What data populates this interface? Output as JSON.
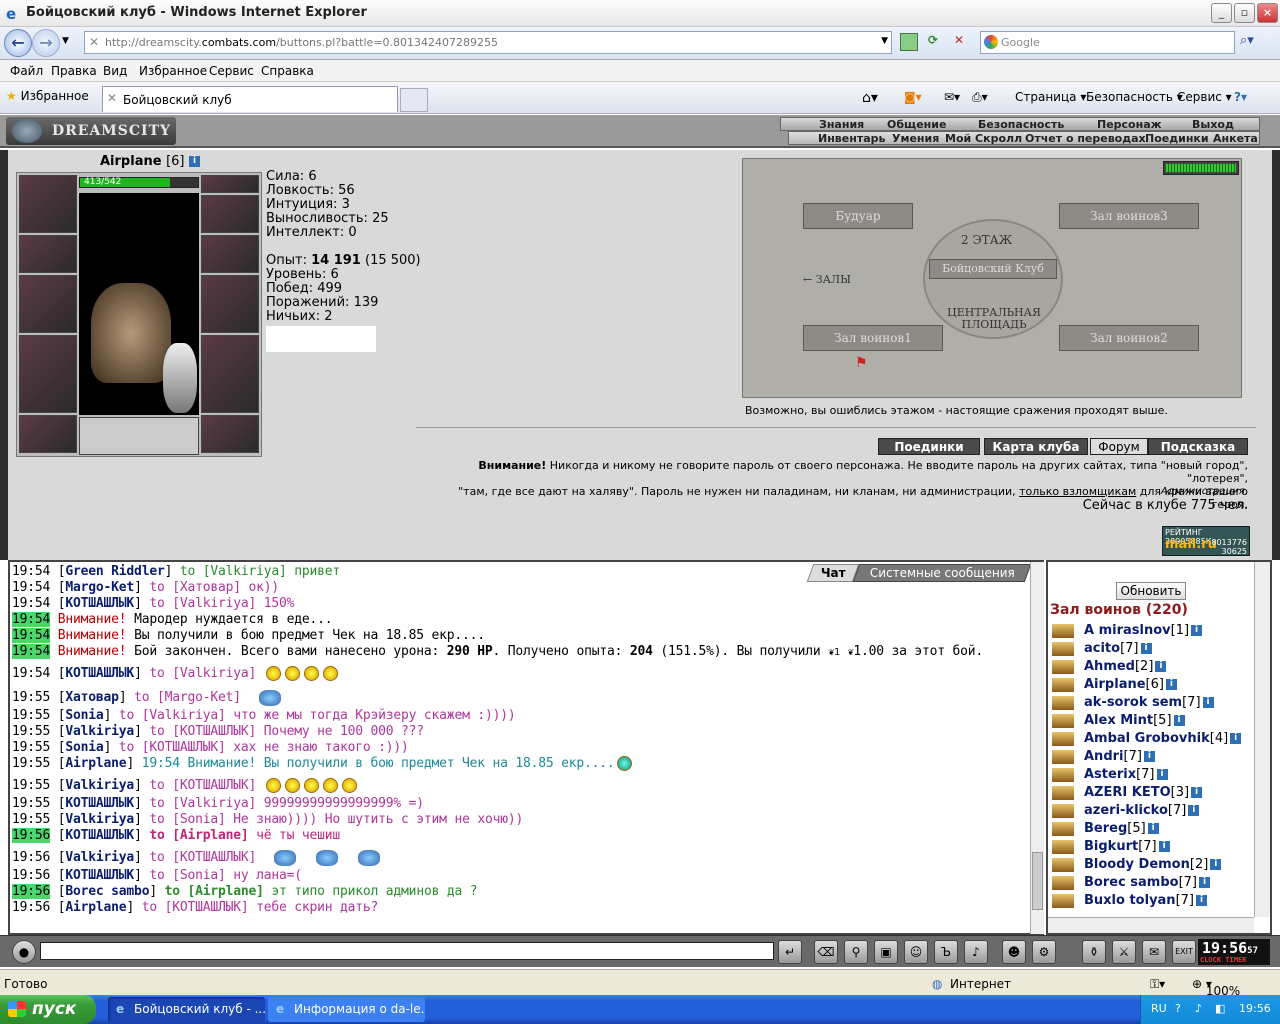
{
  "window": {
    "title": "Бойцовский клуб - Windows Internet Explorer"
  },
  "address": {
    "url_prefix": "http://dreamscity.",
    "url_domain": "combats.com",
    "url_suffix": "/buttons.pl?battle=0.801342407289255",
    "search_placeholder": "Google"
  },
  "menu": [
    "Файл",
    "Правка",
    "Вид",
    "Избранное",
    "Сервис",
    "Справка"
  ],
  "tabbar": {
    "favorites": "Избранное",
    "tab_title": "Бойцовский клуб",
    "page_menu": "Страница",
    "safety_menu": "Безопасность",
    "tools_menu": "Сервис"
  },
  "game_nav": {
    "logo": "DREAMSCITY",
    "row1": [
      "Знания",
      "Общение",
      "Безопасность",
      "Персонаж",
      "Выход"
    ],
    "row2": [
      "Инвентарь",
      "Умения",
      "Мой Скролл",
      "Отчет о переводах",
      "Поединки",
      "Анкета"
    ]
  },
  "character": {
    "name": "Airplane",
    "level": "[6]",
    "hp": "413/542",
    "hp_fraction": 0.762,
    "stats": [
      {
        "label": "Сила:",
        "value": "6"
      },
      {
        "label": "Ловкость:",
        "value": "56"
      },
      {
        "label": "Интуиция:",
        "value": "3"
      },
      {
        "label": "Выносливость:",
        "value": "25"
      },
      {
        "label": "Интеллект:",
        "value": "0"
      }
    ],
    "exp_label": "Опыт:",
    "exp_value": "14 191",
    "exp_next": "(15 500)",
    "stats2": [
      {
        "label": "Уровень:",
        "value": "6"
      },
      {
        "label": "Побед:",
        "value": "499"
      },
      {
        "label": "Поражений:",
        "value": "139"
      },
      {
        "label": "Ничьих:",
        "value": "2"
      }
    ]
  },
  "map": {
    "floor_label": "2 ЭТАЖ",
    "center_label": "Бойцовский Клуб",
    "plaza_label": "ЦЕНТРАЛЬНАЯ ПЛОЩАДЬ",
    "rooms": [
      "Будуар",
      "Зал воинов3",
      "Зал воинов1",
      "Зал воинов2"
    ],
    "halls_label": "← ЗАЛЫ",
    "note": "Возможно, вы ошиблись этажом - настоящие сражения проходят выше."
  },
  "buttons": [
    "Поединки",
    "Карта клуба",
    "Форум",
    "Подсказка"
  ],
  "warning": {
    "bold": "Внимание!",
    "text1": " Никогда и никому не говорите пароль от своего персонажа. Не вводите пароль на других сайтах, типа \"новый город\", \"лотерея\",",
    "text2": "\"там, где все дают на халяву\". Пароль не нужен ни паладинам, ни кланам, ни администрации, ",
    "link": "только взломщикам",
    "text3": " для кражи вашего героя.",
    "admin": "Администрация.",
    "online": "Сейчас в клубе 775 чел."
  },
  "mailru": {
    "line1": "РЕЙТИНГ 28905885К",
    "logo": "mail.ru",
    "n1": "8013776",
    "n2": "30625"
  },
  "chat_tabs": [
    "Чат",
    "Системные сообщения"
  ],
  "chat": [
    {
      "t": "19:54",
      "a": "Green Riddler",
      "to": "Valkiriya",
      "m": "привет"
    },
    {
      "t": "19:54",
      "a": "Margo-Ket",
      "to": "Хатовар",
      "m": "ок))"
    },
    {
      "t": "19:54",
      "a": "КОТШАШЛЫК",
      "to": "Valkiriya",
      "m": "150%"
    },
    {
      "t": "19:54",
      "sys": "Внимание!",
      "m": "Мародер нуждается в еде..."
    },
    {
      "t": "19:54",
      "sys": "Внимание!",
      "m": "Вы получили в бою предмет Чек на 18.85 екр...."
    },
    {
      "t": "19:54",
      "sys": "Внимание!",
      "m1": "Бой закончен. Всего вами нанесено урона:",
      "b1": "290 HP",
      "m2": ". Получено опыта:",
      "b2": "204",
      "m3": "(151.5%). Вы получили",
      "m4": "1",
      "m5": "1.00 за этот бой."
    },
    {
      "t": "19:54",
      "a": "КОТШАШЛЫК",
      "to": "Valkiriya",
      "m": ""
    },
    {
      "t": "19:55",
      "a": "Хатовар",
      "to": "Margo-Ket",
      "m": ""
    },
    {
      "t": "19:55",
      "a": "Sonia",
      "to": "Valkiriya",
      "m": "что же мы тогда Крэйзеру скажем :))))"
    },
    {
      "t": "19:55",
      "a": "Valkiriya",
      "to": "КОТШАШЛЫК",
      "m": "Почему не 100 000 ???"
    },
    {
      "t": "19:55",
      "a": "Sonia",
      "to": "КОТШАШЛЫК",
      "m": "хах не знаю такого :)))"
    },
    {
      "t": "19:55",
      "a": "Airplane",
      "m": "19:54 Внимание! Вы получили в бою предмет Чек на 18.85 екр...."
    },
    {
      "t": "19:55",
      "a": "Valkiriya",
      "to": "КОТШАШЛЫК",
      "m": ""
    },
    {
      "t": "19:55",
      "a": "КОТШАШЛЫК",
      "to": "Valkiriya",
      "m": "99999999999999999% =)"
    },
    {
      "t": "19:55",
      "a": "Valkiriya",
      "to": "Sonia",
      "m": "Не знаю)))) Но шутить с этим не хочю))"
    },
    {
      "t": "19:56",
      "a": "КОТШАШЛЫК",
      "to": "Airplane",
      "m": "чё ты чешиш"
    },
    {
      "t": "19:56",
      "a": "Valkiriya",
      "to": "КОТШАШЛЫК",
      "m": ""
    },
    {
      "t": "19:56",
      "a": "КОТШАШЛЫК",
      "to": "Sonia",
      "m": "ну лана=("
    },
    {
      "t": "19:56",
      "a": "Borec sambo",
      "to": "Airplane",
      "m": "эт типо прикол админов да ?"
    },
    {
      "t": "19:56",
      "a": "Airplane",
      "to": "КОТШАШЛЫК",
      "m": "тебе скрин дать?"
    }
  ],
  "users": {
    "refresh": "Обновить",
    "hall": "Зал воинов (220)",
    "list": [
      {
        "n": "A miraslnov",
        "l": "[1]"
      },
      {
        "n": "acito",
        "l": "[7]"
      },
      {
        "n": "Ahmed",
        "l": "[2]"
      },
      {
        "n": "Airplane",
        "l": "[6]"
      },
      {
        "n": "ak-sorok sem",
        "l": "[7]"
      },
      {
        "n": "Alex Mint",
        "l": "[5]"
      },
      {
        "n": "Ambal Grobovhik",
        "l": "[4]"
      },
      {
        "n": "Andri",
        "l": "[7]"
      },
      {
        "n": "Asterix",
        "l": "[7]"
      },
      {
        "n": "AZERI KETO",
        "l": "[3]"
      },
      {
        "n": "azeri-klicko",
        "l": "[7]"
      },
      {
        "n": "Bereg",
        "l": "[5]"
      },
      {
        "n": "Bigkurt",
        "l": "[7]"
      },
      {
        "n": "Bloody Demon",
        "l": "[2]"
      },
      {
        "n": "Borec sambo",
        "l": "[7]"
      },
      {
        "n": "Buxlo tolyan",
        "l": "[7]"
      }
    ]
  },
  "clock": {
    "time": "19:56",
    "sec": "57",
    "label": "CLOCK TIMER"
  },
  "status": {
    "left": "Готово",
    "zone": "Интернет",
    "zoom": "100%"
  },
  "taskbar": {
    "start": "пуск",
    "tasks": [
      "Бойцовский клуб - ...",
      "Информация о da-le..."
    ],
    "lang": "RU",
    "time": "19:56"
  }
}
